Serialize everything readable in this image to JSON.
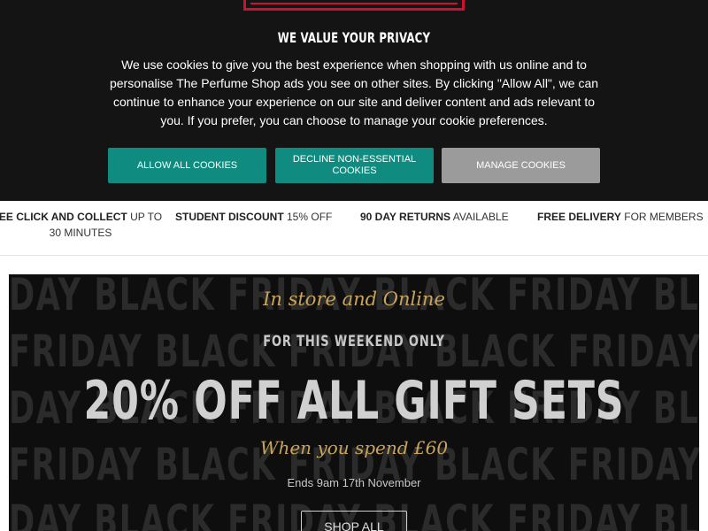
{
  "cookie_banner": {
    "title": "WE VALUE YOUR PRIVACY",
    "body": "We use cookies to give you the best experience when shopping with us online and to personalise The Perfume Shop ads you see on other sites. By clicking \"Allow All\", we can continue to enhance your experience on our site and deliver content and ads relevant to you. If you prefer, you can choose to manage your cookie preferences.",
    "allow_label": "ALLOW ALL COOKIES",
    "decline_label": "DECLINE NON-ESSENTIAL COOKIES",
    "manage_label": "MANAGE COOKIES"
  },
  "usps": [
    {
      "bold": "EE CLICK AND COLLECT",
      "rest": " UP TO 30 MINUTES"
    },
    {
      "bold": "STUDENT DISCOUNT",
      "rest": " 15% OFF"
    },
    {
      "bold": "90 DAY RETURNS",
      "rest": " AVAILABLE"
    },
    {
      "bold": "FREE DELIVERY",
      "rest": " FOR MEMBERS"
    }
  ],
  "hero": {
    "background_rows": [
      "DAY BLACK FRIDAY BLACK FRIDAY BLA",
      "FRIDAY BLACK FRIDAY BLACK FRIDAY",
      "DAY BLACK FRIDAY BLACK FRIDAY BLA",
      "FRIDAY BLACK FRIDAY BLACK FRIDAY",
      "DAY BLACK FRIDAY BLACK FRIDAY BLA"
    ],
    "script_top": "In store and Online",
    "weekend": "FOR THIS WEEKEND ONLY",
    "headline": "20% OFF ALL GIFT SETS",
    "script_bottom": "When you spend £60",
    "ends": "Ends 9am 17th November",
    "shop_label": "SHOP ALL"
  },
  "colors": {
    "banner_bg": "#141414",
    "accent_green": "#0f8c7f",
    "manage_grey": "#9b9b9b",
    "brand_red": "#d0102e",
    "gold": "#c9a45a"
  }
}
